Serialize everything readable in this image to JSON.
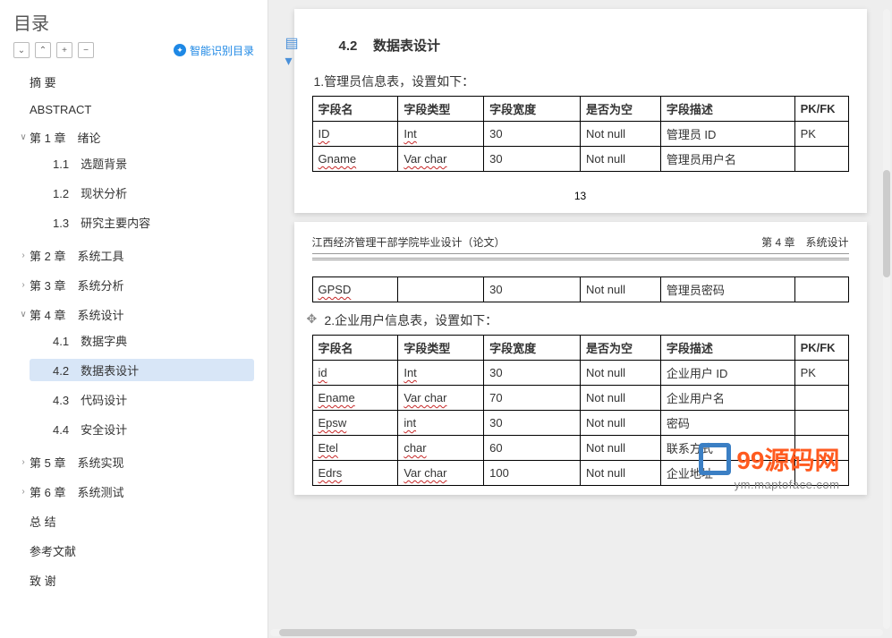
{
  "sidebar": {
    "title": "目录",
    "smart_recog": "智能识别目录",
    "controls": [
      "⌄",
      "⌃",
      "+",
      "−"
    ],
    "items": [
      {
        "label": "摘  要",
        "children": null
      },
      {
        "label": "ABSTRACT",
        "children": null
      },
      {
        "label": "第 1 章　绪论",
        "expanded": true,
        "children": [
          {
            "label": "1.1　选题背景"
          },
          {
            "label": "1.2　现状分析"
          },
          {
            "label": "1.3　研究主要内容"
          }
        ]
      },
      {
        "label": "第 2 章　系统工具",
        "expanded": false,
        "children": []
      },
      {
        "label": "第 3 章　系统分析",
        "expanded": false,
        "children": []
      },
      {
        "label": "第 4 章　系统设计",
        "expanded": true,
        "children": [
          {
            "label": "4.1　数据字典"
          },
          {
            "label": "4.2　数据表设计",
            "active": true
          },
          {
            "label": "4.3　代码设计"
          },
          {
            "label": "4.4　安全设计"
          }
        ]
      },
      {
        "label": "第 5 章　系统实现",
        "expanded": false,
        "children": []
      },
      {
        "label": "第 6 章　系统测试",
        "expanded": false,
        "children": []
      },
      {
        "label": "总  结",
        "children": null
      },
      {
        "label": "参考文献",
        "children": null
      },
      {
        "label": "致  谢",
        "children": null
      }
    ]
  },
  "doc": {
    "section_no": "4.2",
    "section_title": "数据表设计",
    "page_number": "13",
    "page2_header_left": "江西经济管理干部学院毕业设计（论文）",
    "page2_header_right": "第 4 章　系统设计",
    "table1": {
      "caption": "1.管理员信息表，设置如下：",
      "headers": [
        "字段名",
        "字段类型",
        "字段宽度",
        "是否为空",
        "字段描述",
        "PK/FK"
      ],
      "rows": [
        [
          "ID",
          "Int",
          "30",
          "Not null",
          "管理员 ID",
          "PK"
        ],
        [
          "Gname",
          "Var char",
          "30",
          "Not null",
          "管理员用户名",
          ""
        ]
      ]
    },
    "table1b_rows": [
      [
        "GPSD",
        "",
        "30",
        "Not null",
        "管理员密码",
        ""
      ]
    ],
    "table2": {
      "caption": "2.企业用户信息表，设置如下：",
      "headers": [
        "字段名",
        "字段类型",
        "字段宽度",
        "是否为空",
        "字段描述",
        "PK/FK"
      ],
      "rows": [
        [
          "id",
          "Int",
          "30",
          "Not null",
          "企业用户 ID",
          "PK"
        ],
        [
          "Ename",
          "Var char",
          "70",
          "Not null",
          "企业用户名",
          ""
        ],
        [
          "Epsw",
          "int",
          "30",
          "Not null",
          "密码",
          ""
        ],
        [
          "Etel",
          "char",
          "60",
          "Not null",
          "联系方式",
          ""
        ],
        [
          "Edrs",
          "Var char",
          "100",
          "Not null",
          "企业地址",
          ""
        ]
      ]
    },
    "watermark_text": "99源码网",
    "watermark_host": "ym.maptoface.com"
  }
}
